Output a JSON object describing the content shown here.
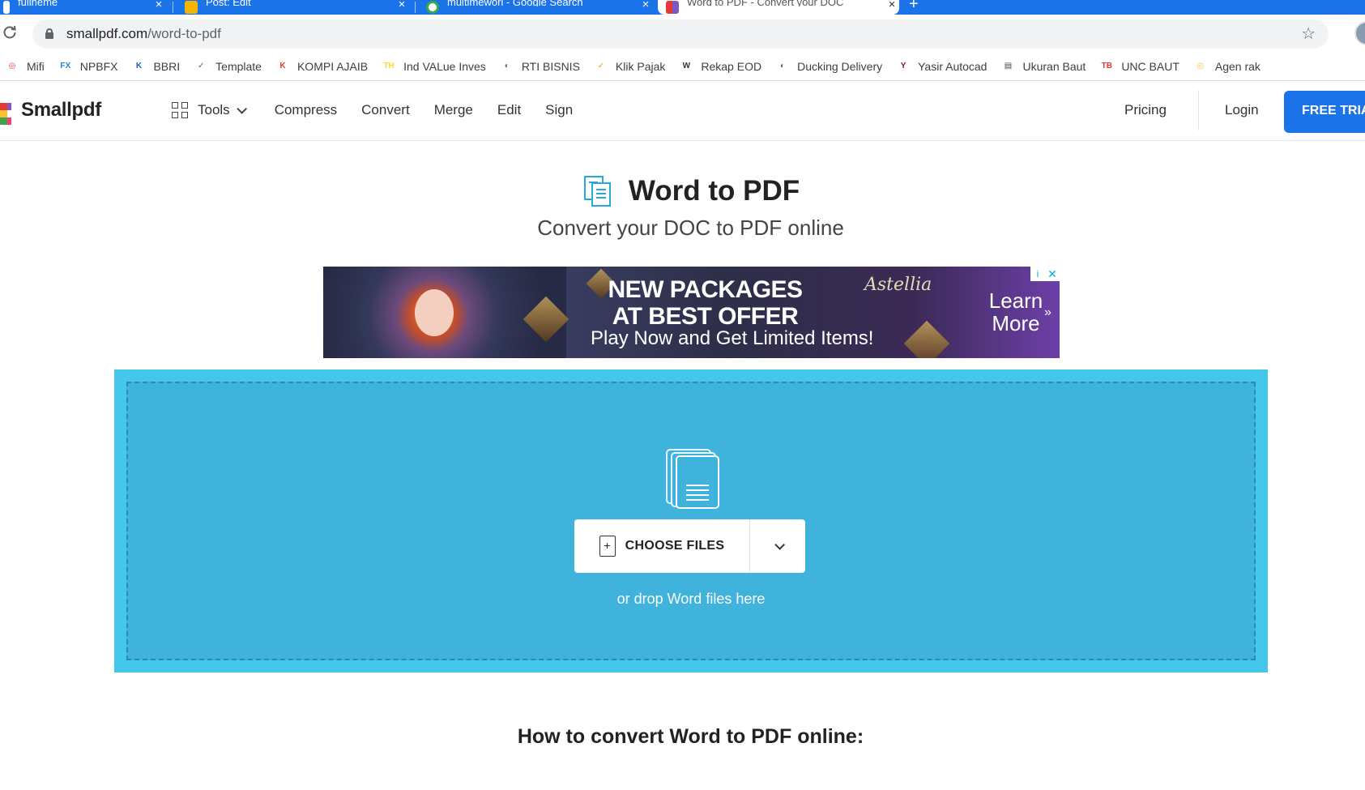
{
  "browser": {
    "tabs": [
      {
        "title": "fullheme",
        "favicon_color": "#ffffff"
      },
      {
        "title": "Post: Edit",
        "favicon_color": "#f4b400"
      },
      {
        "title": "multimeworl - Google Search",
        "favicon_color": "#34a853"
      },
      {
        "title": "Word to PDF - Convert your DOC",
        "favicon_color": "#e53935",
        "active": true
      }
    ],
    "new_tab_label": "+",
    "close_glyph": "×",
    "url_host": "smallpdf.com",
    "url_path": "/word-to-pdf"
  },
  "bookmarks": [
    {
      "label": "Mifi",
      "icon": "mifi-icon",
      "color": "#e53935",
      "glyph": "◎"
    },
    {
      "label": "NPBFX",
      "icon": "npbfx-icon",
      "color": "#1e88e5",
      "glyph": "FX"
    },
    {
      "label": "BBRI",
      "icon": "bbri-icon",
      "color": "#1565c0",
      "glyph": "K"
    },
    {
      "label": "Template",
      "icon": "template-icon",
      "color": "#2e7d32",
      "glyph": "✓"
    },
    {
      "label": "KOMPI AJAIB",
      "icon": "kompi-icon",
      "color": "#e53935",
      "glyph": "K"
    },
    {
      "label": "Ind VALue Inves",
      "icon": "th-icon",
      "color": "#fdd835",
      "glyph": "TH"
    },
    {
      "label": "RTI BISNIS",
      "icon": "globe-icon",
      "color": "#5f6368",
      "glyph": "◐"
    },
    {
      "label": "Klik Pajak",
      "icon": "checkmark-icon",
      "color": "#ff9800",
      "glyph": "✓"
    },
    {
      "label": "Rekap EOD",
      "icon": "w-icon",
      "color": "#333333",
      "glyph": "W"
    },
    {
      "label": "Ducking Delivery",
      "icon": "globe-icon",
      "color": "#5f6368",
      "glyph": "◐"
    },
    {
      "label": "Yasir Autocad",
      "icon": "y-icon",
      "color": "#8b1a1a",
      "glyph": "Y"
    },
    {
      "label": "Ukuran Baut",
      "icon": "bolt-icon",
      "color": "#444444",
      "glyph": "▤"
    },
    {
      "label": "UNC BAUT",
      "icon": "toolbox-icon",
      "color": "#e53935",
      "glyph": "TB"
    },
    {
      "label": "Agen rak",
      "icon": "agen-icon",
      "color": "#fbc02d",
      "glyph": "◎"
    }
  ],
  "site": {
    "logo_text": "Smallpdf",
    "nav": {
      "tools": "Tools",
      "compress": "Compress",
      "convert": "Convert",
      "merge": "Merge",
      "edit": "Edit",
      "sign": "Sign"
    },
    "pricing": "Pricing",
    "login": "Login",
    "free_trial": "FREE TRIAL",
    "brand_color": "#1a73e8"
  },
  "hero": {
    "title": "Word to PDF",
    "subtitle": "Convert your DOC to PDF online"
  },
  "ad": {
    "headline_1": "NEW PACKAGES",
    "headline_2": "AT BEST OFFER",
    "subline": "Play Now and Get Limited Items!",
    "brand": "Astellia",
    "cta_1": "Learn",
    "cta_2": "More",
    "info_glyph": "i",
    "close_glyph": "✕"
  },
  "dropzone": {
    "choose_files": "CHOOSE FILES",
    "hint": "or drop Word files here",
    "bg_color": "#45c7ec"
  },
  "howto_title": "How to convert Word to PDF online:"
}
